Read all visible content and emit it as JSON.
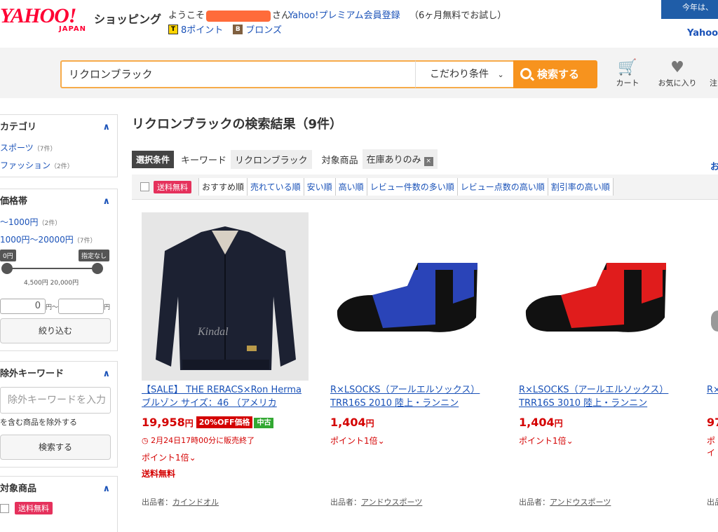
{
  "header": {
    "logo_main": "YAHOO!",
    "logo_sub": "JAPAN",
    "service_name": "ショッピング",
    "welcome_prefix": "ようこそ",
    "welcome_suffix": "さん",
    "premium_link": "Yahoo!プレミアム会員登録",
    "premium_note": "（6ヶ月無料でお試し）",
    "points_label": "8ポイント",
    "points_icon_text": "T",
    "rank_icon_text": "B",
    "rank_label": "ブロンズ",
    "banner_text": "今年は、",
    "yahoo_link": "Yahoo"
  },
  "search": {
    "query": "リクロンブラック",
    "conditions_label": "こだわり条件",
    "submit_label": "検索する",
    "cart_label": "カート",
    "favorites_label": "お気に入り",
    "extra_label": "注"
  },
  "sidebar": {
    "category_title": "カテゴリ",
    "categories": [
      {
        "label": "スポーツ",
        "count": "（7件）"
      },
      {
        "label": "ファッション",
        "count": "（2件）"
      }
    ],
    "price_title": "価格帯",
    "price_ranges": [
      {
        "label": "～1000円",
        "count": "（2件）"
      },
      {
        "label": "1000円～20000円",
        "count": "（7件）"
      }
    ],
    "slider_min_label": "0円",
    "slider_max_label": "指定なし",
    "slider_ticks": "4,500円 20,000円",
    "price_min_value": "0",
    "price_unit_mid": "円～",
    "price_unit_end": "円",
    "narrow_button": "絞り込む",
    "exclude_title": "除外キーワード",
    "exclude_placeholder": "除外キーワードを入力",
    "exclude_note": "を含む商品を除外する",
    "exclude_button": "検索する",
    "target_title": "対象商品",
    "target_free_shipping": "送料無料"
  },
  "results": {
    "title": "リクロンブラックの検索結果（9件）",
    "filter_label": "選択条件",
    "keyword_label": "キーワード",
    "keyword_value": "リクロンブラック",
    "target_label": "対象商品",
    "target_value": "在庫ありのみ",
    "target_remove": "×",
    "right_link": "お",
    "sort_free_shipping": "送料無料",
    "sort_options": [
      "おすすめ順",
      "売れている順",
      "安い順",
      "高い順",
      "レビュー件数の多い順",
      "レビュー点数の高い順",
      "割引率の高い順"
    ]
  },
  "products": [
    {
      "name": "【SALE】 THE RERACS×Ron Herma ブルゾン サイズ：46 （アメリカ",
      "price": "19,958",
      "yen": "円",
      "discount_badge": "20%OFF価格",
      "condition_badge": "中古",
      "end_time": "2月24日17時00分に販売終了",
      "points": "ポイント1倍",
      "shipping": "送料無料",
      "seller_label": "出品者：",
      "seller": "カインドオル",
      "watermark": "Kindal"
    },
    {
      "name": "R×LSOCKS（アールエルソックス） TRR16S 2010 陸上・ランニン",
      "price": "1,404",
      "yen": "円",
      "points": "ポイント1倍",
      "seller_label": "出品者：",
      "seller": "アンドウスポーツ",
      "sock_color": "#2a44b8"
    },
    {
      "name": "R×LSOCKS（アールエルソックス） TRR16S 3010 陸上・ランニン",
      "price": "1,404",
      "yen": "円",
      "points": "ポイント1倍",
      "seller_label": "出品者：",
      "seller": "アンドウスポーツ",
      "sock_color": "#e01c1c"
    },
    {
      "name": "R×",
      "price": "97",
      "points": "ポイ",
      "seller_label": "出品"
    }
  ]
}
